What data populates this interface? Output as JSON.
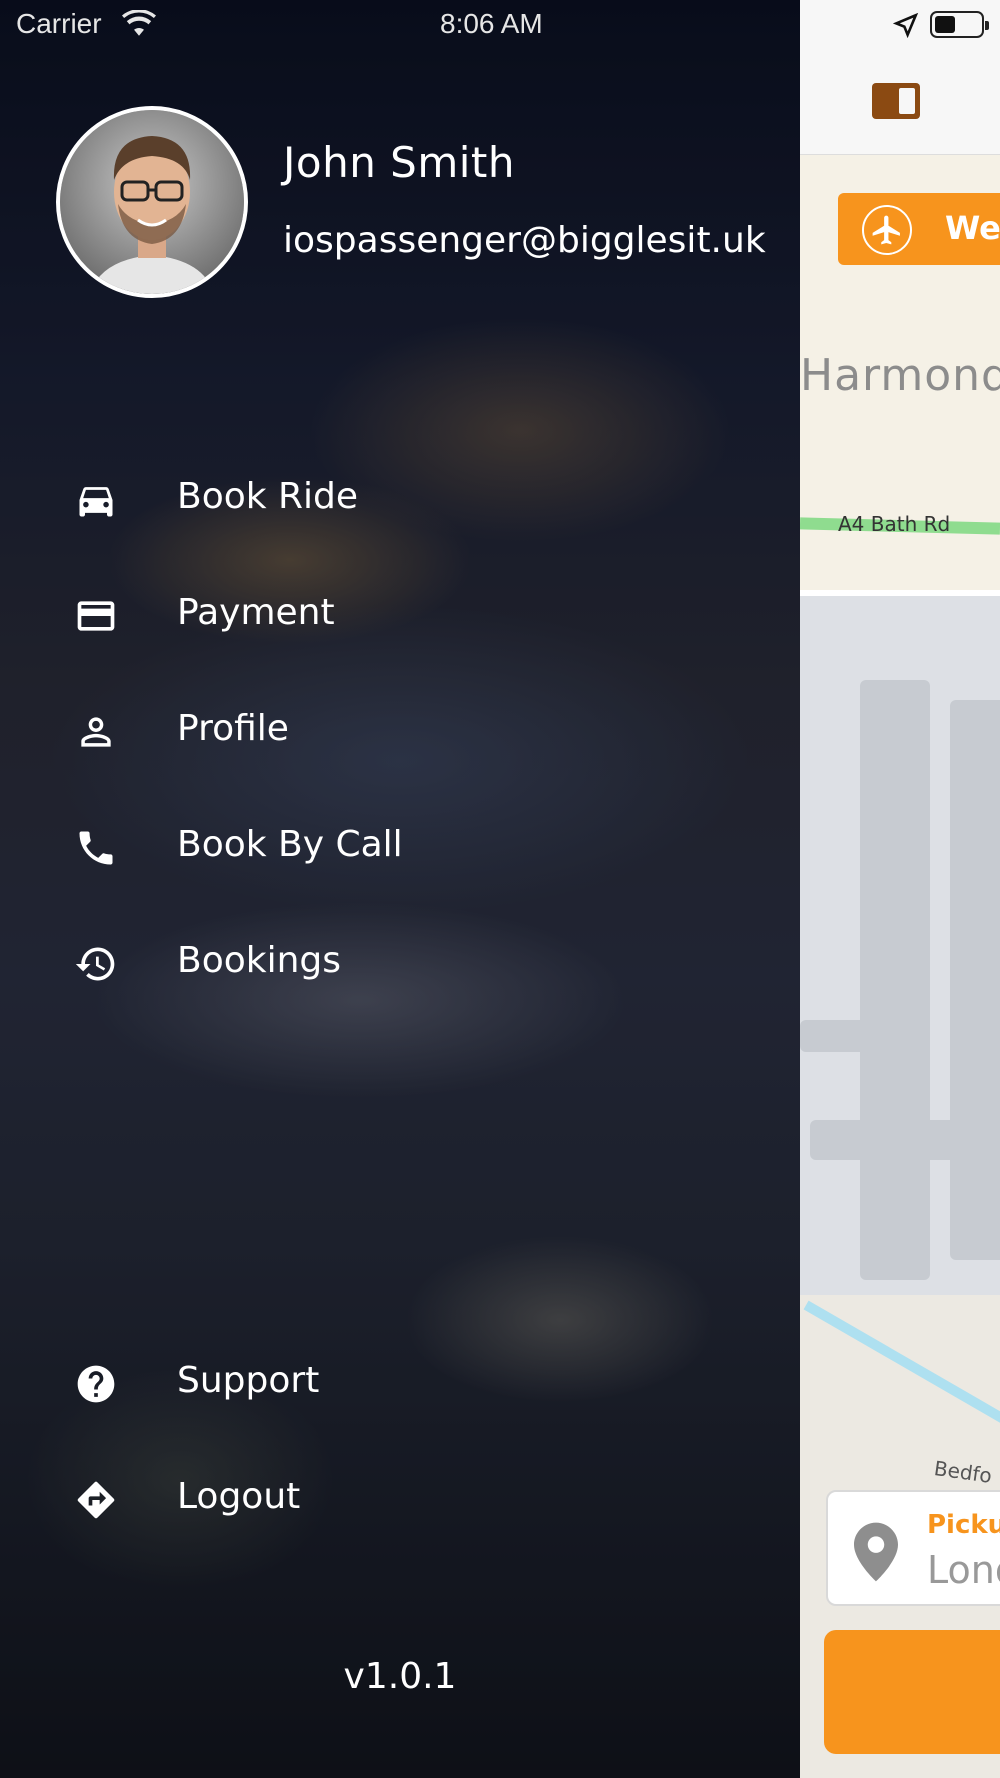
{
  "status_bar": {
    "carrier": "Carrier",
    "time": "8:06 AM"
  },
  "drawer": {
    "user": {
      "name": "John Smith",
      "email": "iospassenger@bigglesit.uk"
    },
    "menu_items": [
      {
        "label": "Book Ride",
        "icon": "car-icon"
      },
      {
        "label": "Payment",
        "icon": "credit-card-icon"
      },
      {
        "label": "Profile",
        "icon": "person-icon"
      },
      {
        "label": "Book By Call",
        "icon": "phone-icon"
      },
      {
        "label": "Bookings",
        "icon": "history-icon"
      }
    ],
    "secondary_items": [
      {
        "label": "Support",
        "icon": "help-circle-icon"
      },
      {
        "label": "Logout",
        "icon": "directions-icon"
      }
    ],
    "version": "v1.0.1"
  },
  "map": {
    "airport_button_label": "We",
    "place_label": "Harmonds",
    "road_label": "A4  Bath Rd",
    "street_label": "Bedfo",
    "pickup": {
      "title": "Pickup",
      "value": "Lond"
    }
  },
  "colors": {
    "accent": "#f7941d",
    "drawer_text": "#ffffff",
    "map_background": "#e9ebee"
  }
}
